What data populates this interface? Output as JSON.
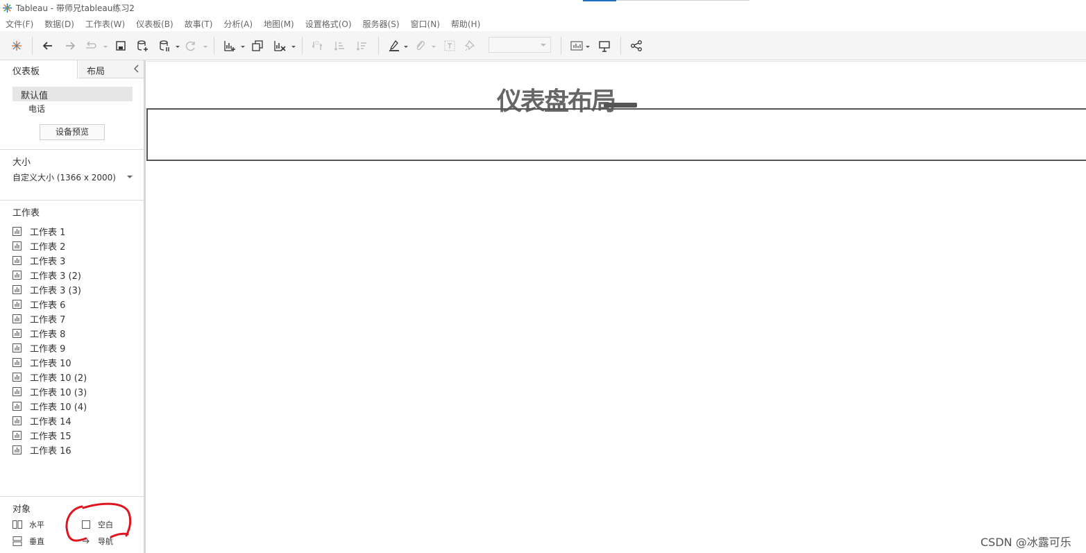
{
  "window": {
    "title": "Tableau - 带师兄tableau练习2"
  },
  "menu": {
    "items": [
      "文件(F)",
      "数据(D)",
      "工作表(W)",
      "仪表板(B)",
      "故事(T)",
      "分析(A)",
      "地图(M)",
      "设置格式(O)",
      "服务器(S)",
      "窗口(N)",
      "帮助(H)"
    ]
  },
  "toolbar": {
    "icons": [
      "tableau-logo-icon",
      "undo-icon",
      "redo-icon",
      "replay-icon",
      "save-icon",
      "new-datasource-icon",
      "pause-updates-icon",
      "refresh-icon",
      "new-worksheet-icon",
      "duplicate-icon",
      "clear-sheet-icon",
      "swap-icon",
      "sort-ascending-icon",
      "sort-descending-icon",
      "highlight-icon",
      "annotate-icon",
      "label-icon",
      "pin-icon",
      "show-me-icon",
      "presentation-icon",
      "share-icon"
    ]
  },
  "leftpanel": {
    "tab_dashboard": "仪表板",
    "tab_layout": "布局",
    "device_default": "默认值",
    "device_phone": "电话",
    "preview_button": "设备预览",
    "size_label": "大小",
    "size_value": "自定义大小 (1366 x 2000)",
    "sheets_label": "工作表",
    "sheets": [
      "工作表 1",
      "工作表 2",
      "工作表 3",
      "工作表 3 (2)",
      "工作表 3 (3)",
      "工作表 6",
      "工作表 7",
      "工作表 8",
      "工作表 9",
      "工作表 10",
      "工作表 10 (2)",
      "工作表 10 (3)",
      "工作表 10 (4)",
      "工作表 14",
      "工作表 15",
      "工作表 16"
    ],
    "objects_label": "对象",
    "obj_horizontal": "水平",
    "obj_blank": "空白",
    "obj_vertical": "垂直",
    "obj_navigation": "导航"
  },
  "canvas": {
    "title": "仪表盘布局"
  },
  "watermark": "CSDN @冰露可乐",
  "colors": {
    "toolbar_bg": "#f5f5f5",
    "annotation": "#e0141e"
  }
}
